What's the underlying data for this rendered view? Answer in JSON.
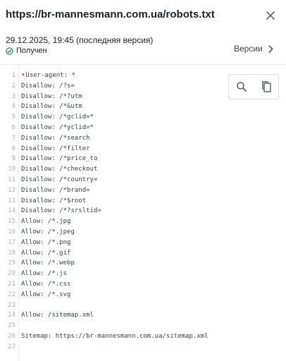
{
  "header": {
    "title": "https://br-mannesmann.com.ua/robots.txt",
    "close_icon": "close-icon"
  },
  "meta": {
    "date": "29.12.2025, 19:45 (последняя версия)",
    "status": "Получен",
    "status_icon": "check-circle-icon",
    "status_color": "#188038",
    "versions_label": "Версии",
    "versions_icon": "chevron-right-icon"
  },
  "toolbar": {
    "search_icon": "search-icon",
    "copy_icon": "copy-icon"
  },
  "code": {
    "lines": [
      {
        "n": "1",
        "text": "User-agent: *"
      },
      {
        "n": "2",
        "text": "Disallow: /?s="
      },
      {
        "n": "3",
        "text": "Disallow: /*?utm"
      },
      {
        "n": "4",
        "text": "Disallow: /*&utm"
      },
      {
        "n": "5",
        "text": "Disallow: /*gclid=*"
      },
      {
        "n": "6",
        "text": "Disallow: /*yclid=*"
      },
      {
        "n": "7",
        "text": "Disallow: /*search"
      },
      {
        "n": "8",
        "text": "Disallow: /*filter"
      },
      {
        "n": "9",
        "text": "Disallow: /*price_to"
      },
      {
        "n": "10",
        "text": "Disallow: /*checkout"
      },
      {
        "n": "11",
        "text": "Disallow: /*country="
      },
      {
        "n": "12",
        "text": "Disallow: /*brand="
      },
      {
        "n": "13",
        "text": "Disallow: /*$root"
      },
      {
        "n": "14",
        "text": "Disallow: /*?srsltid="
      },
      {
        "n": "15",
        "text": "Allow: /*.jpg"
      },
      {
        "n": "16",
        "text": "Allow: /*.jpeg"
      },
      {
        "n": "17",
        "text": "Allow: /*.png"
      },
      {
        "n": "18",
        "text": "Allow: /*.gif"
      },
      {
        "n": "19",
        "text": "Allow: /*.webp"
      },
      {
        "n": "20",
        "text": "Allow: /*.js"
      },
      {
        "n": "21",
        "text": "Allow: /*.css"
      },
      {
        "n": "22",
        "text": "Allow: /*.svg"
      },
      {
        "n": "23",
        "text": ""
      },
      {
        "n": "24",
        "text": "Allow: /sitemap.xml"
      },
      {
        "n": "25",
        "text": ""
      },
      {
        "n": "26",
        "text": "Sitemap: https://br-mannesmann.com.ua/sitemap.xml"
      },
      {
        "n": "27",
        "text": ""
      }
    ]
  }
}
